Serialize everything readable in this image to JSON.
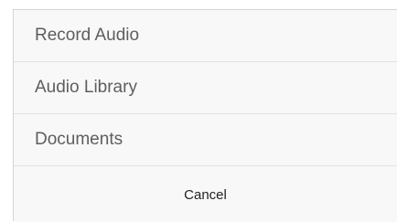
{
  "menu": {
    "options": [
      {
        "label": "Record Audio"
      },
      {
        "label": "Audio Library"
      },
      {
        "label": "Documents"
      }
    ],
    "cancel_label": "Cancel"
  }
}
